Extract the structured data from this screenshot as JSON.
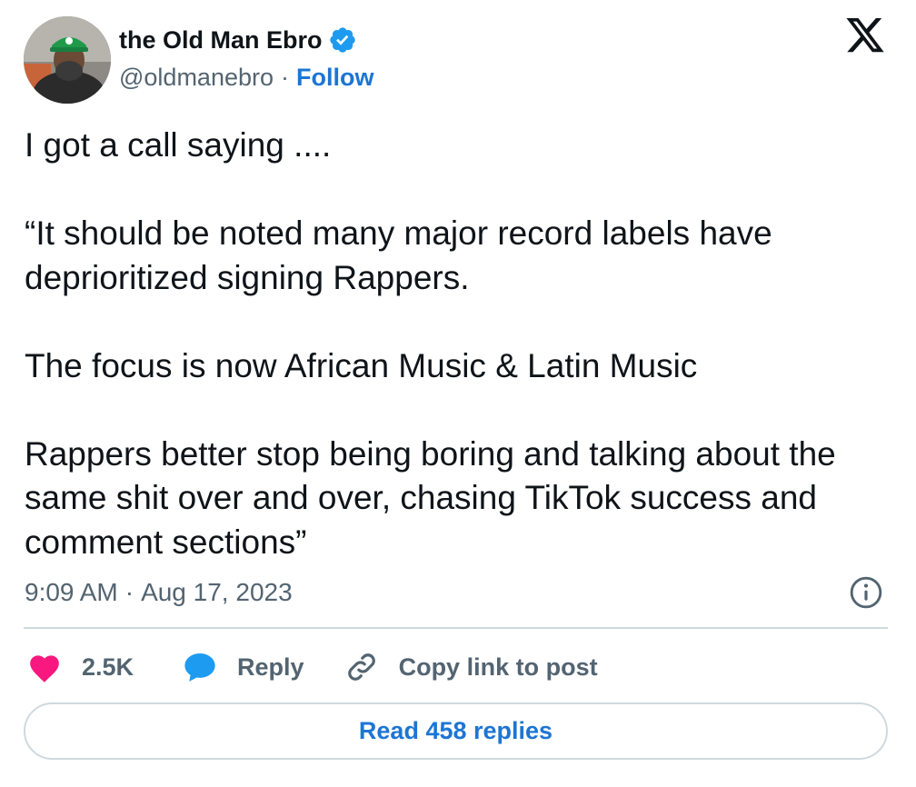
{
  "author": {
    "name": "the Old Man Ebro",
    "handle": "@oldmanebro",
    "separator": "·",
    "follow_label": "Follow",
    "verified": true,
    "avatar_icon": "profile-photo"
  },
  "platform": {
    "logo": "x-logo"
  },
  "tweet": {
    "paragraphs": [
      "I got a call saying ....",
      "“It should be noted many major record labels have deprioritized signing Rappers.",
      "The focus is now African Music & Latin Music",
      "Rappers better stop being boring and talking about the same shit over and over, chasing TikTok success and comment sections”"
    ],
    "time": "9:09 AM",
    "separator": "·",
    "date": "Aug 17, 2023"
  },
  "actions": {
    "likes_count": "2.5K",
    "reply_label": "Reply",
    "copy_link_label": "Copy link to post",
    "read_replies_label": "Read 458 replies"
  },
  "colors": {
    "accent": "#1d75d4",
    "like": "#f91880",
    "reply_icon": "#1d9bf0",
    "verified": "#1d9bf0",
    "secondary_text": "#536471",
    "border": "#cfd9de"
  }
}
